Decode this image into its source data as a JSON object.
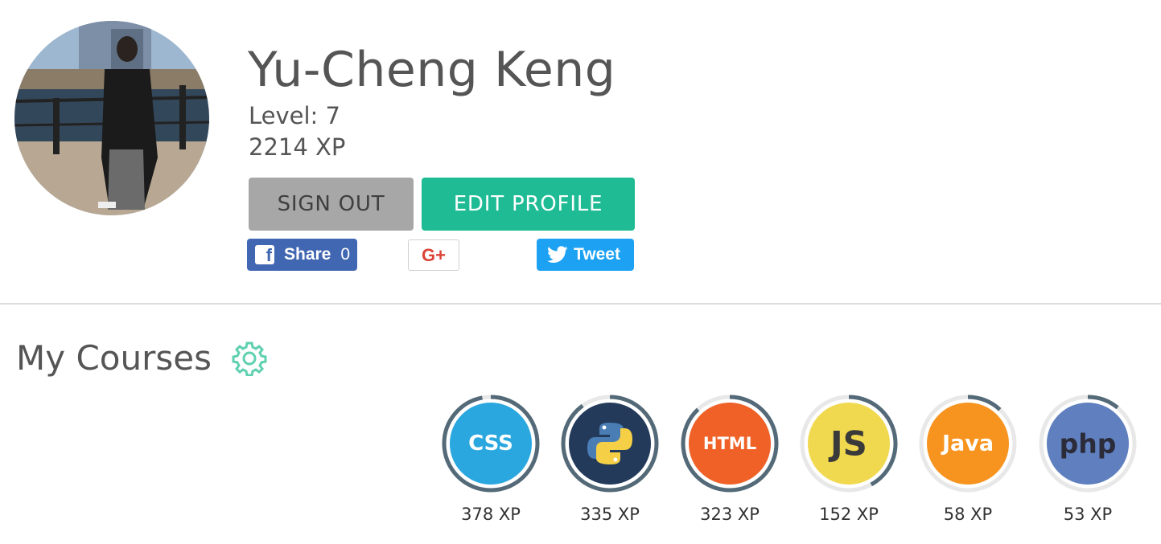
{
  "profile": {
    "name": "Yu-Cheng Keng",
    "level": "Level: 7",
    "xp": "2214 XP"
  },
  "actions": {
    "sign_out": "SIGN OUT",
    "edit_profile": "EDIT PROFILE"
  },
  "social": {
    "facebook_label": "Share",
    "facebook_count": "0",
    "gplus_label": "G+",
    "tweet_label": "Tweet"
  },
  "courses": {
    "title": "My Courses",
    "items": [
      {
        "name": "CSS",
        "icon_text": "CSS",
        "xp": "378 XP",
        "color": "#2aa7df",
        "progress": 0.97
      },
      {
        "name": "Python",
        "icon_text": "",
        "xp": "335 XP",
        "color": "#233a5b",
        "progress": 0.9
      },
      {
        "name": "HTML",
        "icon_text": "HTML",
        "xp": "323 XP",
        "color": "#ef6127",
        "progress": 0.88
      },
      {
        "name": "JavaScript",
        "icon_text": "JS",
        "xp": "152 XP",
        "color": "#f0d94f",
        "progress": 0.42
      },
      {
        "name": "Java",
        "icon_text": "Java",
        "xp": "58 XP",
        "color": "#f7941f",
        "progress": 0.12
      },
      {
        "name": "PHP",
        "icon_text": "php",
        "xp": "53 XP",
        "color": "#5f7fbf",
        "progress": 0.11
      }
    ]
  },
  "colors": {
    "accent": "#1fbb95",
    "sign_out_bg": "#a7a7a7",
    "facebook": "#4267b2",
    "twitter": "#1da1f2",
    "ring_track": "#e8e8e8",
    "ring_progress": "#546a78"
  },
  "icons": {
    "settings": "gear-icon",
    "facebook": "facebook-icon",
    "twitter": "twitter-bird-icon"
  }
}
